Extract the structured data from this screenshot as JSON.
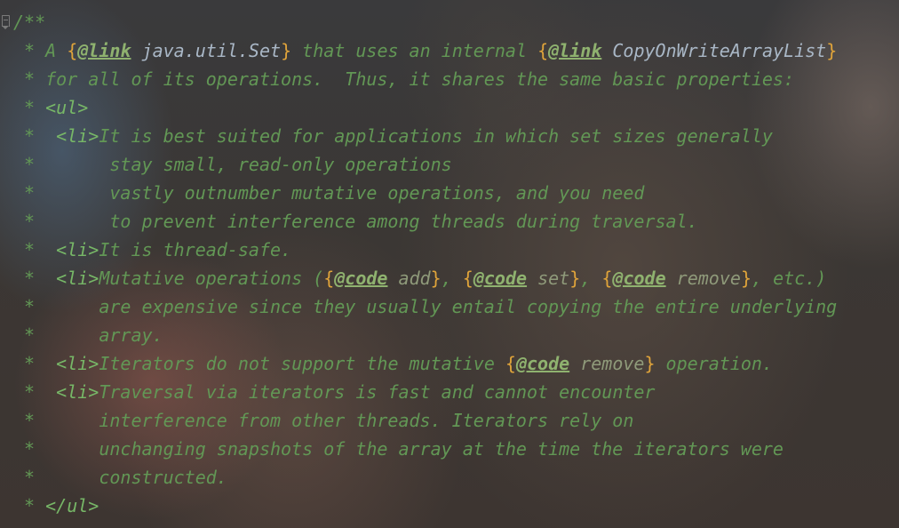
{
  "editor": {
    "language": "java",
    "comment_lines": [
      [
        {
          "t": "/**",
          "k": "c"
        }
      ],
      [
        {
          "t": " * A ",
          "k": "c"
        },
        {
          "t": "{",
          "k": "b"
        },
        {
          "t": "@link",
          "k": "a"
        },
        {
          "t": " java.util.Set",
          "k": "r"
        },
        {
          "t": "}",
          "k": "b"
        },
        {
          "t": " that uses an internal ",
          "k": "c"
        },
        {
          "t": "{",
          "k": "b"
        },
        {
          "t": "@link",
          "k": "a"
        },
        {
          "t": " CopyOnWriteArrayList",
          "k": "r"
        },
        {
          "t": "}",
          "k": "b"
        }
      ],
      [
        {
          "t": " * for all of its operations.  Thus, it shares the same basic properties:",
          "k": "c"
        }
      ],
      [
        {
          "t": " * ",
          "k": "c"
        },
        {
          "t": "<ul>",
          "k": "g"
        }
      ],
      [
        {
          "t": " *  ",
          "k": "c"
        },
        {
          "t": "<li>",
          "k": "g"
        },
        {
          "t": "It is best suited for applications in which set sizes generally",
          "k": "c"
        }
      ],
      [
        {
          "t": " *       stay small, read-only operations",
          "k": "c"
        }
      ],
      [
        {
          "t": " *       vastly outnumber mutative operations, and you need",
          "k": "c"
        }
      ],
      [
        {
          "t": " *       to prevent interference among threads during traversal.",
          "k": "c"
        }
      ],
      [
        {
          "t": " *  ",
          "k": "c"
        },
        {
          "t": "<li>",
          "k": "g"
        },
        {
          "t": "It is thread-safe.",
          "k": "c"
        }
      ],
      [
        {
          "t": " *  ",
          "k": "c"
        },
        {
          "t": "<li>",
          "k": "g"
        },
        {
          "t": "Mutative operations (",
          "k": "c"
        },
        {
          "t": "{",
          "k": "b"
        },
        {
          "t": "@code",
          "k": "a"
        },
        {
          "t": " add",
          "k": "p"
        },
        {
          "t": "}",
          "k": "b"
        },
        {
          "t": ", ",
          "k": "c"
        },
        {
          "t": "{",
          "k": "b"
        },
        {
          "t": "@code",
          "k": "a"
        },
        {
          "t": " set",
          "k": "p"
        },
        {
          "t": "}",
          "k": "b"
        },
        {
          "t": ", ",
          "k": "c"
        },
        {
          "t": "{",
          "k": "b"
        },
        {
          "t": "@code",
          "k": "a"
        },
        {
          "t": " remove",
          "k": "p"
        },
        {
          "t": "}",
          "k": "b"
        },
        {
          "t": ", etc.)",
          "k": "c"
        }
      ],
      [
        {
          "t": " *      are expensive since they usually entail copying the entire underlying",
          "k": "c"
        }
      ],
      [
        {
          "t": " *      array.",
          "k": "c"
        }
      ],
      [
        {
          "t": " *  ",
          "k": "c"
        },
        {
          "t": "<li>",
          "k": "g"
        },
        {
          "t": "Iterators do not support the mutative ",
          "k": "c"
        },
        {
          "t": "{",
          "k": "b"
        },
        {
          "t": "@code",
          "k": "a"
        },
        {
          "t": " remove",
          "k": "p"
        },
        {
          "t": "}",
          "k": "b"
        },
        {
          "t": " operation.",
          "k": "c"
        }
      ],
      [
        {
          "t": " *  ",
          "k": "c"
        },
        {
          "t": "<li>",
          "k": "g"
        },
        {
          "t": "Traversal via iterators is fast and cannot encounter",
          "k": "c"
        }
      ],
      [
        {
          "t": " *      interference from other threads. Iterators rely on",
          "k": "c"
        }
      ],
      [
        {
          "t": " *      unchanging snapshots of the array at the time the iterators were",
          "k": "c"
        }
      ],
      [
        {
          "t": " *      constructed.",
          "k": "c"
        }
      ],
      [
        {
          "t": " * ",
          "k": "c"
        },
        {
          "t": "</ul>",
          "k": "g"
        }
      ]
    ]
  },
  "colors": {
    "comment": "#629755",
    "html_tag": "#77b767",
    "brace": "#e0a43a",
    "javadoc_tag": "#8fb26f",
    "link_reference": "#a9b7c6"
  }
}
